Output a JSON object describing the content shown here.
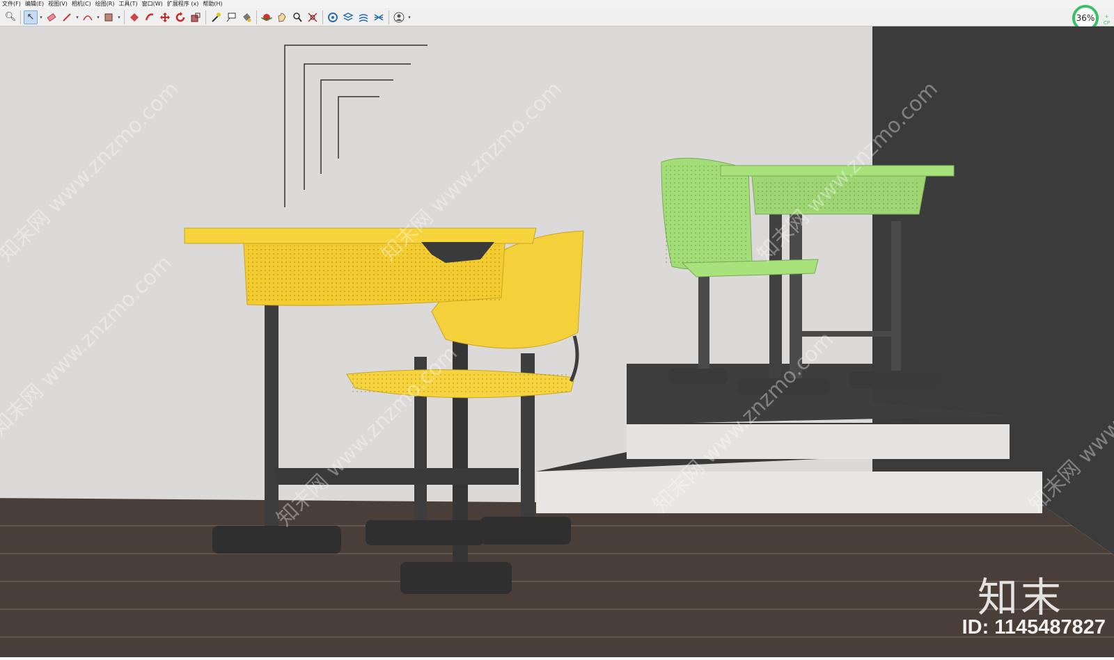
{
  "menu": [
    "文件(F)",
    "编辑(E)",
    "视图(V)",
    "相机(C)",
    "绘图(R)",
    "工具(T)",
    "窗口(W)",
    "扩展程序 (x)",
    "帮助(H)"
  ],
  "toolbar": {
    "tools": [
      "zoom-icon",
      "select-arrow-icon",
      "eraser-icon",
      "pencil-line-icon",
      "arc-icon",
      "shape-rectangle-icon",
      "push-pull-icon",
      "follow-me-icon",
      "move-icon",
      "rotate-icon",
      "scale-icon",
      "tape-measure-icon",
      "text-label-icon",
      "paint-bucket-icon",
      "orbit-icon",
      "pan-icon",
      "zoom-icon",
      "zoom-extents-icon",
      "components-icon",
      "layers-icon",
      "styles-icon",
      "scenes-icon",
      "user-account-icon"
    ]
  },
  "status": {
    "progress_label": "36%",
    "progress_value": 0.36,
    "side_label": "+\nCP"
  },
  "watermark": {
    "logo_text": "知末",
    "id_text": "ID: 1145487827",
    "diagonal_text": "知末网 www.znzmo.com"
  },
  "colors": {
    "yellow_desk": "#f7d33c",
    "green_desk": "#a7e27a",
    "wall": "#dcdad8",
    "dark_wall": "#3b3b3b",
    "floor": "#4a3f38",
    "frame": "#3a3a3a",
    "accent": "#3bc06a"
  }
}
